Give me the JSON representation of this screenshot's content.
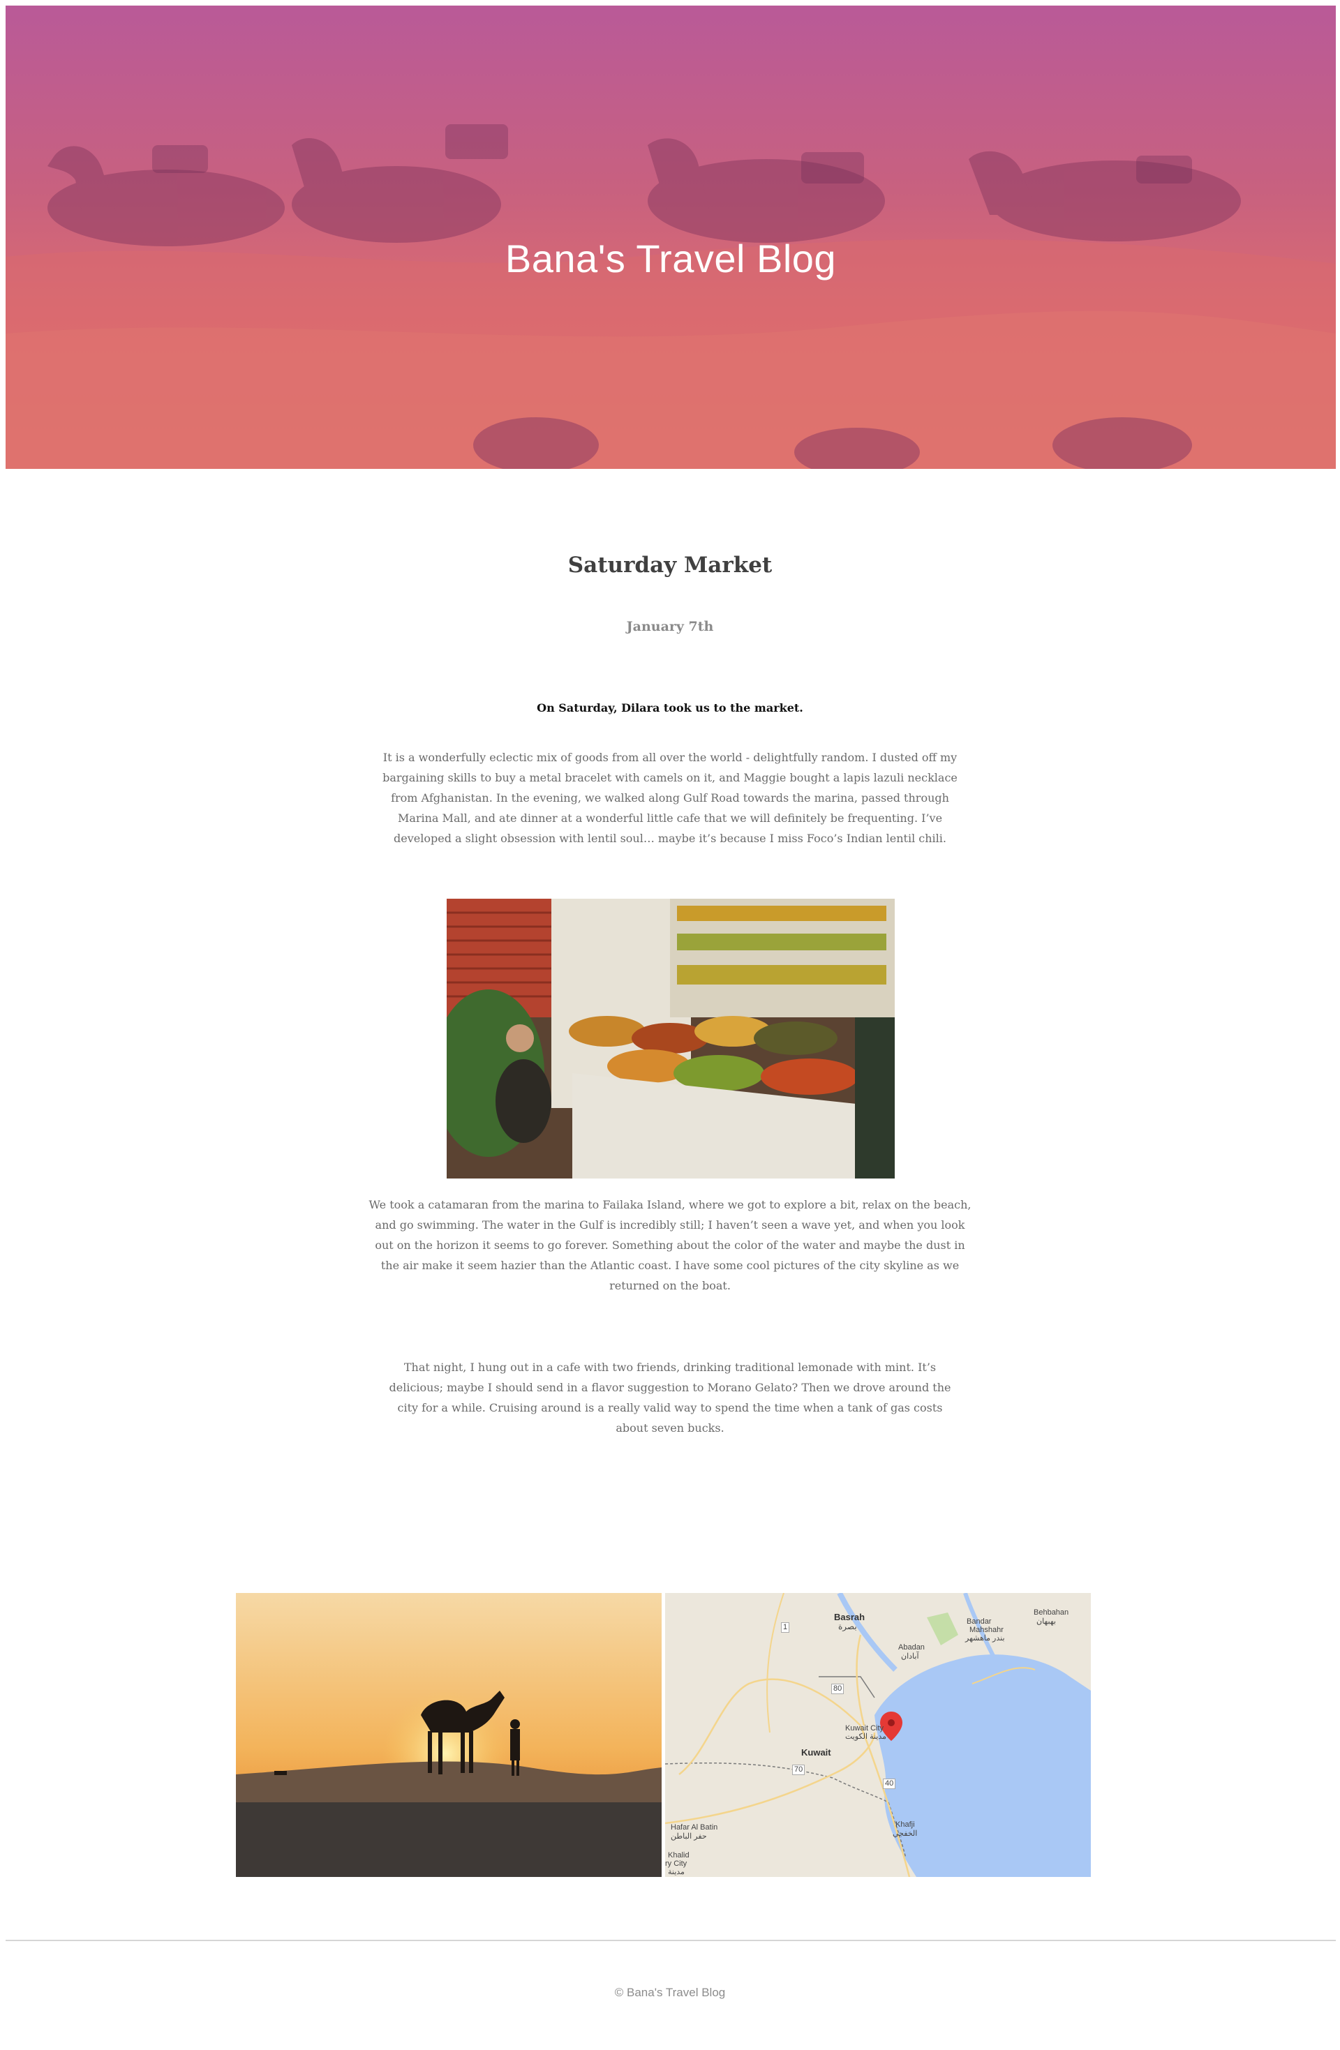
{
  "hero": {
    "title": "Bana's Travel Blog"
  },
  "post": {
    "title": "Saturday Market",
    "date": "January 7th",
    "lead": "On Saturday, Dilara took us to the market.",
    "paragraphs": [
      "It is a wonderfully eclectic mix of goods from all over the world - delightfully random. I dusted off my bargaining skills to buy a metal bracelet with camels on it, and Maggie bought a lapis lazuli necklace from Afghanistan. In the evening, we walked along Gulf Road towards the marina, passed through Marina Mall, and ate dinner at a wonderful little cafe that we will definitely be frequenting. I’ve developed a slight obsession with lentil soul… maybe it’s because I miss Foco’s Indian lentil chili.",
      "We took a catamaran from the marina to Failaka Island, where we got to explore a bit, relax on the beach, and go swimming. The water in the Gulf is incredibly still; I haven’t seen a wave yet, and when you look out on the horizon it seems to go forever. Something about the color of the water and maybe the dust in the air make it seem hazier than the Atlantic coast. I have some cool pictures of the city skyline as we returned on the boat.",
      "That night, I hung out in a cafe with two friends, drinking traditional lemonade with mint. It’s delicious; maybe I should send in a flavor suggestion to Morano Gelato? Then we drove around the city for a while. Cruising around is a really valid way to spend the time when a tank of gas costs about seven bucks."
    ]
  },
  "map": {
    "labels": {
      "basrah": "Basrah",
      "basrah_ar": "بصرة",
      "abadan": "Abadan",
      "abadan_ar": "آبادان",
      "bandar": "Bandar",
      "mahshahr": "Mahshahr",
      "mahshahr_ar": "بندر ماهشهر",
      "behbahan": "Behbahan",
      "behbahan_ar": "بهبهان",
      "kuwait_city": "Kuwait City",
      "kuwait_city_ar": "مدينة الكويت",
      "kuwait": "Kuwait",
      "hafar": "Hafar Al Batin",
      "hafar_ar": "حفر الباطن",
      "khafji": "Khafji",
      "khafji_ar": "الخفجي",
      "khalid": "Khalid",
      "khalid2": "ry City",
      "khalid_ar": "مدينة",
      "road_80": "80",
      "road_70": "70",
      "road_40": "40",
      "road_1": "1"
    },
    "colors": {
      "water": "#a9c8f5",
      "land": "#ece7dc",
      "park": "#c5dea8",
      "marker": "#e53935"
    }
  },
  "footer": {
    "text": "© Bana's Travel Blog"
  }
}
